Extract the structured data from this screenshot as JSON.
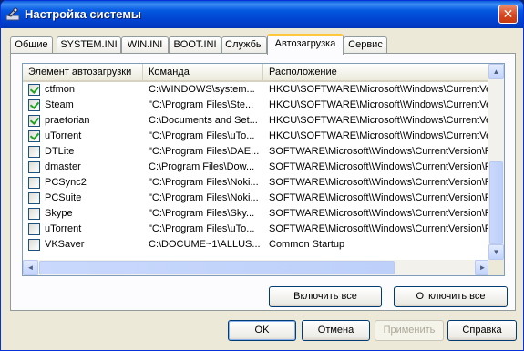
{
  "window": {
    "title": "Настройка системы",
    "close_glyph": "✕"
  },
  "tabs": [
    {
      "label": "Общие"
    },
    {
      "label": "SYSTEM.INI"
    },
    {
      "label": "WIN.INI"
    },
    {
      "label": "BOOT.INI"
    },
    {
      "label": "Службы"
    },
    {
      "label": "Автозагрузка",
      "active": true
    },
    {
      "label": "Сервис"
    }
  ],
  "columns": [
    "Элемент автозагрузки",
    "Команда",
    "Расположение"
  ],
  "rows": [
    {
      "checked": true,
      "name": "ctfmon",
      "command": "C:\\WINDOWS\\system...",
      "location": "HKCU\\SOFTWARE\\Microsoft\\Windows\\CurrentVer..."
    },
    {
      "checked": true,
      "name": "Steam",
      "command": "\"C:\\Program Files\\Ste...",
      "location": "HKCU\\SOFTWARE\\Microsoft\\Windows\\CurrentVer..."
    },
    {
      "checked": true,
      "name": "praetorian",
      "command": "C:\\Documents and Set...",
      "location": "HKCU\\SOFTWARE\\Microsoft\\Windows\\CurrentVer..."
    },
    {
      "checked": true,
      "name": "uTorrent",
      "command": "\"C:\\Program Files\\uTo...",
      "location": "HKCU\\SOFTWARE\\Microsoft\\Windows\\CurrentVer..."
    },
    {
      "checked": false,
      "name": "DTLite",
      "command": "\"C:\\Program Files\\DAE...",
      "location": "SOFTWARE\\Microsoft\\Windows\\CurrentVersion\\Ru"
    },
    {
      "checked": false,
      "name": "dmaster",
      "command": "C:\\Program Files\\Dow...",
      "location": "SOFTWARE\\Microsoft\\Windows\\CurrentVersion\\Ru"
    },
    {
      "checked": false,
      "name": "PCSync2",
      "command": "\"C:\\Program Files\\Noki...",
      "location": "SOFTWARE\\Microsoft\\Windows\\CurrentVersion\\Ru"
    },
    {
      "checked": false,
      "name": "PCSuite",
      "command": "\"C:\\Program Files\\Noki...",
      "location": "SOFTWARE\\Microsoft\\Windows\\CurrentVersion\\Ru"
    },
    {
      "checked": false,
      "name": "Skype",
      "command": "\"C:\\Program Files\\Sky...",
      "location": "SOFTWARE\\Microsoft\\Windows\\CurrentVersion\\Ru"
    },
    {
      "checked": false,
      "name": "uTorrent",
      "command": "\"C:\\Program Files\\uTo...",
      "location": "SOFTWARE\\Microsoft\\Windows\\CurrentVersion\\Ru"
    },
    {
      "checked": false,
      "name": "VKSaver",
      "command": "C:\\DOCUME~1\\ALLUS...",
      "location": "Common Startup"
    }
  ],
  "panel_buttons": {
    "enable_all": "Включить все",
    "disable_all": "Отключить все"
  },
  "dialog_buttons": {
    "ok": "OK",
    "cancel": "Отмена",
    "apply": "Применить",
    "help": "Справка"
  },
  "scroll": {
    "up": "▲",
    "down": "▼",
    "left": "◄",
    "right": "►"
  },
  "colors": {
    "title_bar": "#0043d1",
    "window_bg": "#ece9d8",
    "tab_highlight": "#ffc83c",
    "checkmark": "#21a121"
  }
}
